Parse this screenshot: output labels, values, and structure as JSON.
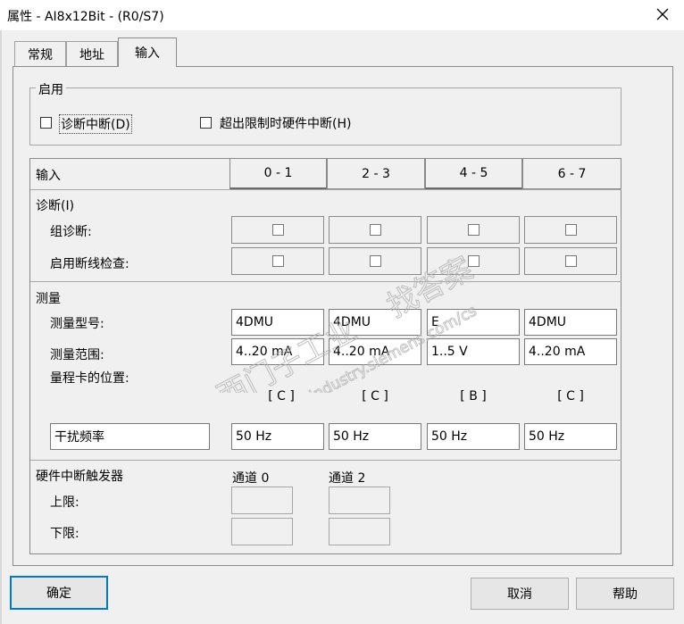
{
  "window": {
    "title": "属性 - AI8x12Bit - (R0/S7)",
    "close_icon": "close-icon"
  },
  "tabs": [
    "常规",
    "地址",
    "输入"
  ],
  "active_tab": "输入",
  "enable_group": {
    "legend": "启用",
    "diag_interrupt": {
      "label": "诊断中断(D)",
      "checked": false
    },
    "limit_interrupt": {
      "label": "超出限制时硬件中断(H)",
      "checked": false
    }
  },
  "table": {
    "header_label": "输入",
    "columns": [
      "0 - 1",
      "2 - 3",
      "4 - 5",
      "6 - 7"
    ],
    "diagnostics": {
      "title": "诊断(I)",
      "group_diag": {
        "label": "组诊断:",
        "values": [
          false,
          false,
          false,
          false
        ]
      },
      "wire_break": {
        "label": "启用断线检查:",
        "values": [
          false,
          false,
          false,
          false
        ]
      }
    },
    "measurement": {
      "title": "测量",
      "type": {
        "label": "测量型号:",
        "values": [
          "4DMU",
          "4DMU",
          "E",
          "4DMU"
        ]
      },
      "range": {
        "label": "测量范围:",
        "values": [
          "4..20 mA",
          "4..20 mA",
          "1..5 V",
          "4..20 mA"
        ]
      },
      "card_position": {
        "label": "量程卡的位置:",
        "values": [
          "[ C ]",
          "[ C ]",
          "[ B ]",
          "[ C ]"
        ]
      },
      "interference": {
        "label": "干扰频率",
        "values": [
          "50 Hz",
          "50 Hz",
          "50 Hz",
          "50 Hz"
        ]
      }
    },
    "hw_trigger": {
      "title": "硬件中断触发器",
      "channels": [
        "通道 0",
        "通道 2"
      ],
      "upper_label": "上限:",
      "lower_label": "下限:"
    }
  },
  "watermark": {
    "line1": "西门子工业",
    "line2": "找答案",
    "url": "support.industry.siemens.com/cs"
  },
  "buttons": {
    "ok": "确定",
    "cancel": "取消",
    "help": "帮助"
  }
}
